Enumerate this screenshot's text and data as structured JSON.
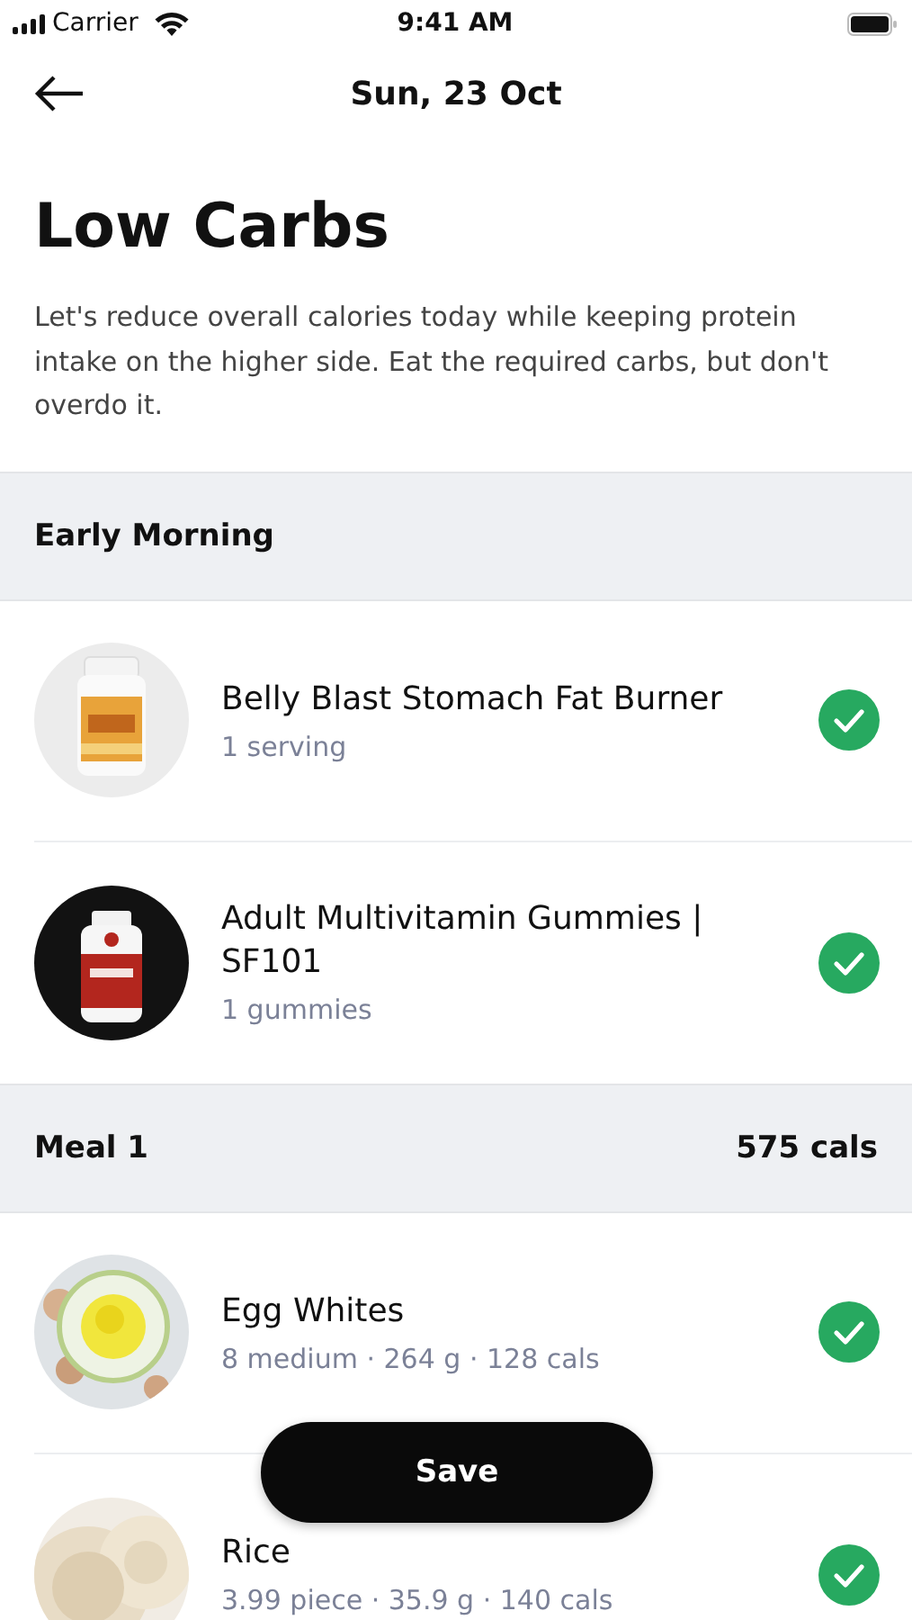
{
  "status_bar": {
    "carrier": "Carrier",
    "time": "9:41 AM"
  },
  "header": {
    "title": "Sun, 23 Oct"
  },
  "plan": {
    "title": "Low Carbs",
    "description": "Let's reduce overall calories today while keeping protein intake on the higher side. Eat the required carbs, but don't overdo it."
  },
  "sections": [
    {
      "title": "Early Morning",
      "items": [
        {
          "name": "Belly Blast Stomach Fat Burner",
          "meta": "1 serving",
          "checked": true
        },
        {
          "name": "Adult Multivitamin Gummies | SF101",
          "meta": "1 gummies",
          "checked": true
        }
      ]
    },
    {
      "title": "Meal 1",
      "calories": "575 cals",
      "items": [
        {
          "name": "Egg Whites",
          "meta": "8 medium · 264 g · 128 cals",
          "checked": true
        },
        {
          "name": "Rice",
          "meta": "3.99 piece · 35.9 g · 140 cals",
          "checked": true
        }
      ]
    }
  ],
  "save_button": "Save"
}
